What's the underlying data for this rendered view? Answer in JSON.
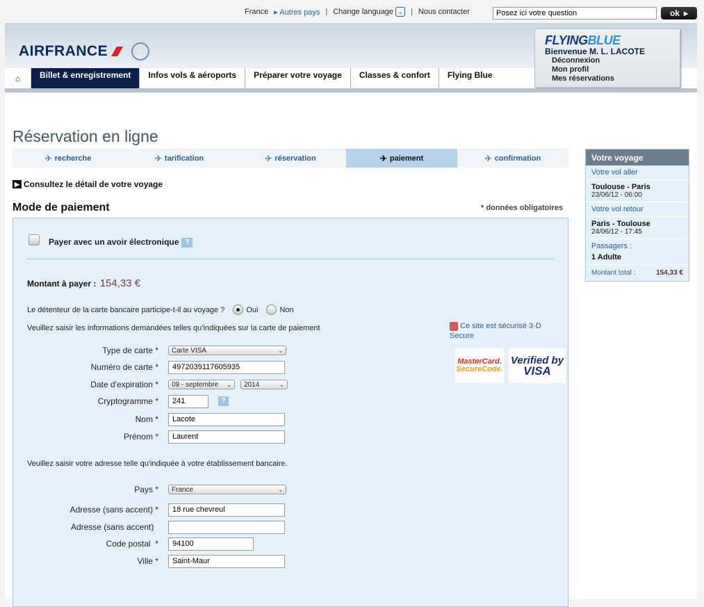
{
  "utility": {
    "country": "France",
    "other_countries": "Autres pays",
    "change_language": "Change language",
    "contact": "Nous contacter",
    "search_value": "Posez ici votre question",
    "ok_label": "ok"
  },
  "header": {
    "logo_text": "AIRFRANCE",
    "nav": [
      "Billet & enregistrement",
      "Infos vols & aéroports",
      "Préparer votre voyage",
      "Classes & confort",
      "Flying Blue"
    ]
  },
  "flyingblue": {
    "logo_part1": "FLYING",
    "logo_part2": "BLUE",
    "welcome": "Bienvenue M. L. LACOTE",
    "links": [
      "Déconnexion",
      "Mon profil",
      "Mes réservations"
    ]
  },
  "page": {
    "title": "Réservation en ligne",
    "steps": [
      "recherche",
      "tarification",
      "réservation",
      "paiement",
      "confirmation"
    ],
    "active_step": "paiement",
    "detail_link": "Consultez le détail de votre voyage",
    "section_title": "Mode de paiement",
    "required_note": "* données obligatoires"
  },
  "payment": {
    "avoir_label": "Payer avec un avoir électronique",
    "help": "?",
    "amount_label": "Montant à payer :",
    "amount_value": "154,33 €",
    "holder_question": "Le détenteur de la carte bancaire participe-t-il au voyage ?",
    "yes": "Oui",
    "no": "Non",
    "card_info": "Veuillez saisir les informations demandées telles qu'indiquées sur la carte de paiement",
    "address_info": "Veuillez saisir votre adresse telle qu'indiquée à votre établissement bancaire.",
    "secure_text": "Ce site est sécurisé 3-D Secure",
    "mastercard_line1": "MasterCard.",
    "mastercard_line2": "SecureCode.",
    "visa_line1": "Verified by",
    "visa_line2": "VISA"
  },
  "fields": {
    "card_type": {
      "label": "Type de carte",
      "value": "Carte VISA"
    },
    "card_number": {
      "label": "Numéro de carte",
      "value": "4972039117605935"
    },
    "expiry": {
      "label": "Date d'expiration",
      "month": "09 - septembre",
      "year": "2014"
    },
    "cvv": {
      "label": "Cryptogramme",
      "value": "241"
    },
    "last_name": {
      "label": "Nom",
      "value": "Lacote"
    },
    "first_name": {
      "label": "Prénom",
      "value": "Laurent"
    },
    "country": {
      "label": "Pays",
      "value": "France"
    },
    "address1": {
      "label": "Adresse (sans accent)",
      "value": "18 rue chevreul"
    },
    "address2": {
      "label": "Adresse (sans accent)",
      "value": ""
    },
    "postal": {
      "label": "Code postal",
      "value": "94100"
    },
    "city": {
      "label": "Ville",
      "value": "Saint-Maur"
    }
  },
  "sidebar": {
    "title": "Votre voyage",
    "outbound_label": "Votre vol aller",
    "outbound_route": "Toulouse - Paris",
    "outbound_date": "23/06/12 - 06:00",
    "return_label": "Votre vol retour",
    "return_route": "Paris - Toulouse",
    "return_date": "24/06/12 - 17:45",
    "passengers_label": "Passagers :",
    "passengers_value": "1 Adulte",
    "total_label": "Montant total :",
    "total_value": "154,33 €"
  }
}
